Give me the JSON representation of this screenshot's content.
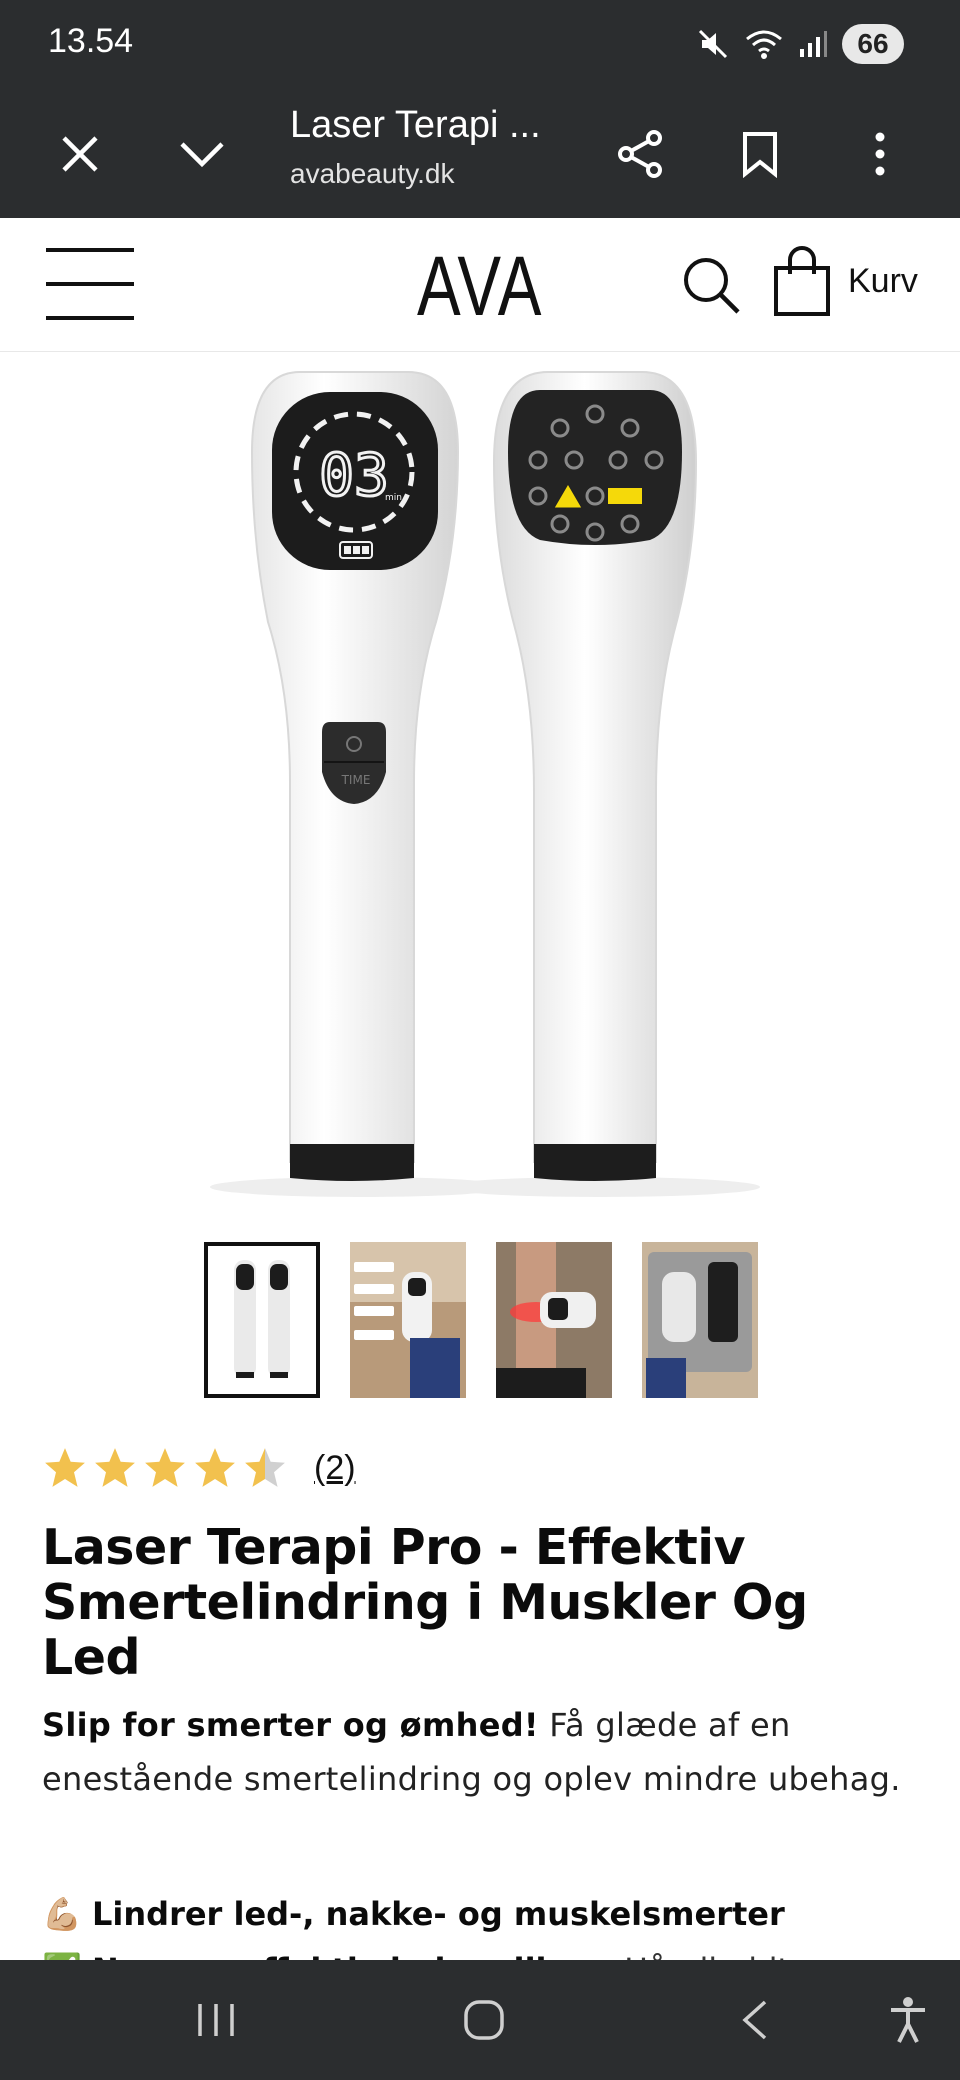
{
  "status_bar": {
    "time": "13.54",
    "battery": "66",
    "icons": [
      "mute-icon",
      "wifi-icon",
      "signal-icon",
      "battery-icon"
    ]
  },
  "browser": {
    "page_title": "Laser Terapi ...",
    "url": "avabeauty.dk",
    "icons": [
      "close-icon",
      "chevron-down-icon",
      "share-icon",
      "bookmark-icon",
      "more-vertical-icon"
    ]
  },
  "site_header": {
    "logo": "AVA",
    "cart_label": "Kurv",
    "icons": [
      "menu-icon",
      "search-icon",
      "cart-bag-icon"
    ]
  },
  "product": {
    "device_screen_text": "03",
    "device_screen_unit": "min",
    "device_time_label": "TIME",
    "thumbnails": [
      {
        "name": "thumbnail-product-front-back",
        "active": true
      },
      {
        "name": "thumbnail-benefits-infographic",
        "active": false
      },
      {
        "name": "thumbnail-leg-treatment",
        "active": false
      },
      {
        "name": "thumbnail-case-contents",
        "active": false
      }
    ],
    "rating": 4.5,
    "rating_max": 5,
    "rating_count": "(2)",
    "title": "Laser Terapi Pro - Effektiv Smertelindring i Muskler Og Led",
    "desc_bold": "Slip for smerter og ømhed!",
    "desc_rest": " Få glæde af en enestående smertelindring og oplev mindre ubehag.",
    "bullets": [
      {
        "emoji": "💪🏼",
        "bold": "Lindrer led-, nakke- og muskelsmerter",
        "rest": ""
      },
      {
        "emoji": "✅",
        "bold": "Nem og effektiv behandling",
        "rest": " - Håndholdt"
      }
    ]
  },
  "colors": {
    "chrome_dark": "#2b2d2f",
    "star_gold": "#f2c14e",
    "star_grey": "#d0d0d0",
    "text": "#0b0b0b"
  },
  "nav_bar": {
    "icons": [
      "recents-icon",
      "home-icon",
      "back-icon",
      "accessibility-icon"
    ]
  }
}
